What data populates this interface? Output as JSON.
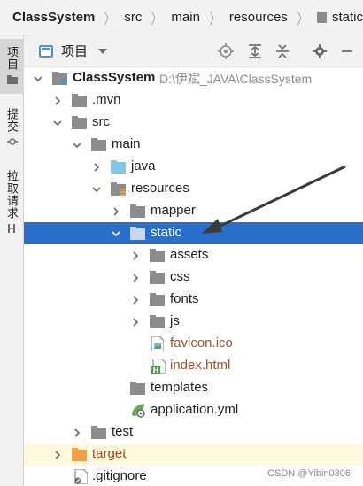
{
  "breadcrumb": {
    "items": [
      "ClassSystem",
      "src",
      "main",
      "resources",
      "static"
    ]
  },
  "side_tabs": [
    {
      "label": "项目",
      "icon": "folder-icon"
    },
    {
      "label": "提交",
      "icon": "commit-icon"
    },
    {
      "label": "拉取请求",
      "icon": "pull-request-icon"
    }
  ],
  "toolbar": {
    "view_label": "项目",
    "buttons": [
      "crosshair-icon",
      "expand-all-icon",
      "collapse-all-icon",
      "gear-icon",
      "minimize-icon"
    ]
  },
  "tree": {
    "root": {
      "name": "ClassSystem",
      "path": "D:\\伊斌_JAVA\\ClassSystem"
    },
    "items": {
      "mvn": ".mvn",
      "src": "src",
      "main": "main",
      "java": "java",
      "resources": "resources",
      "mapper": "mapper",
      "static": "static",
      "assets": "assets",
      "css": "css",
      "fonts": "fonts",
      "js": "js",
      "favicon": "favicon.ico",
      "index": "index.html",
      "templates": "templates",
      "application": "application.yml",
      "test": "test",
      "target": "target",
      "gitignore": ".gitignore"
    },
    "selected": "static"
  },
  "watermark": "CSDN @Yibin0306",
  "colors": {
    "selection": "#2a6fc9",
    "folder_gray": "#8c8c8c",
    "folder_blue": "#7fc8e8",
    "folder_orange": "#f0a04b",
    "excluded_bg": "#fff8dc",
    "excluded_text": "#9b4a1d",
    "file_brown": "#a0522d"
  }
}
